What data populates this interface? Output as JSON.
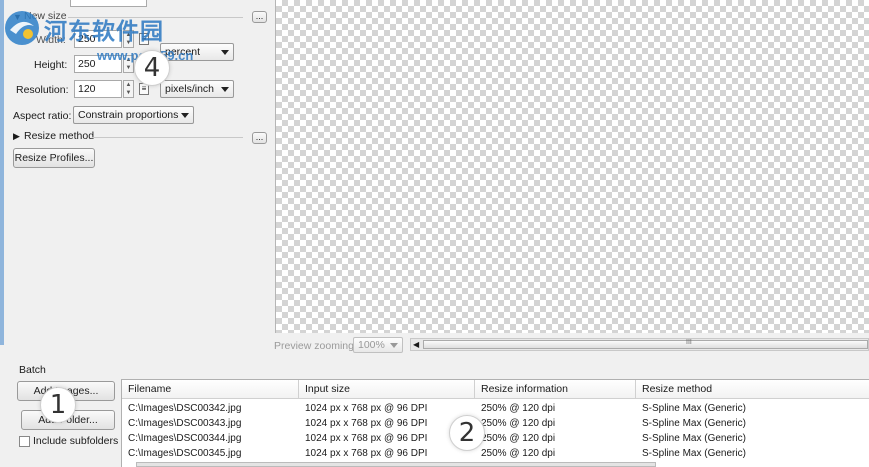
{
  "watermark": {
    "name": "河东软件园",
    "url": "www.pc0359.cn"
  },
  "new_size": {
    "section_label": "New size",
    "width_label": "Width:",
    "width_value": "250",
    "height_label": "Height:",
    "height_value": "250",
    "unit_wh": "percent",
    "resolution_label": "Resolution:",
    "resolution_value": "120",
    "unit_res": "pixels/inch",
    "aspect_label": "Aspect ratio:",
    "aspect_value": "Constrain proportions",
    "resize_method_label": "Resize method",
    "resize_profiles_button": "Resize Profiles...",
    "more_button": "..."
  },
  "preview": {
    "zoom_label": "Preview zooming:",
    "zoom_value": "100%",
    "scroll_grip": "III"
  },
  "batch": {
    "title": "Batch",
    "add_images": "Add Images...",
    "add_folder": "Add Folder...",
    "include_subfolders": "Include subfolders",
    "columns": [
      "Filename",
      "Input size",
      "Resize information",
      "Resize method"
    ],
    "rows": [
      [
        "C:\\Images\\DSC00342.jpg",
        "1024 px x 768 px @ 96 DPI",
        "250% @ 120 dpi",
        "S-Spline Max (Generic)"
      ],
      [
        "C:\\Images\\DSC00343.jpg",
        "1024 px x 768 px @ 96 DPI",
        "250% @ 120 dpi",
        "S-Spline Max (Generic)"
      ],
      [
        "C:\\Images\\DSC00344.jpg",
        "1024 px x 768 px @ 96 DPI",
        "250% @ 120 dpi",
        "S-Spline Max (Generic)"
      ],
      [
        "C:\\Images\\DSC00345.jpg",
        "1024 px x 768 px @ 96 DPI",
        "250% @ 120 dpi",
        "S-Spline Max (Generic)"
      ]
    ]
  },
  "callouts": {
    "one": "1",
    "two": "2",
    "four": "4"
  }
}
